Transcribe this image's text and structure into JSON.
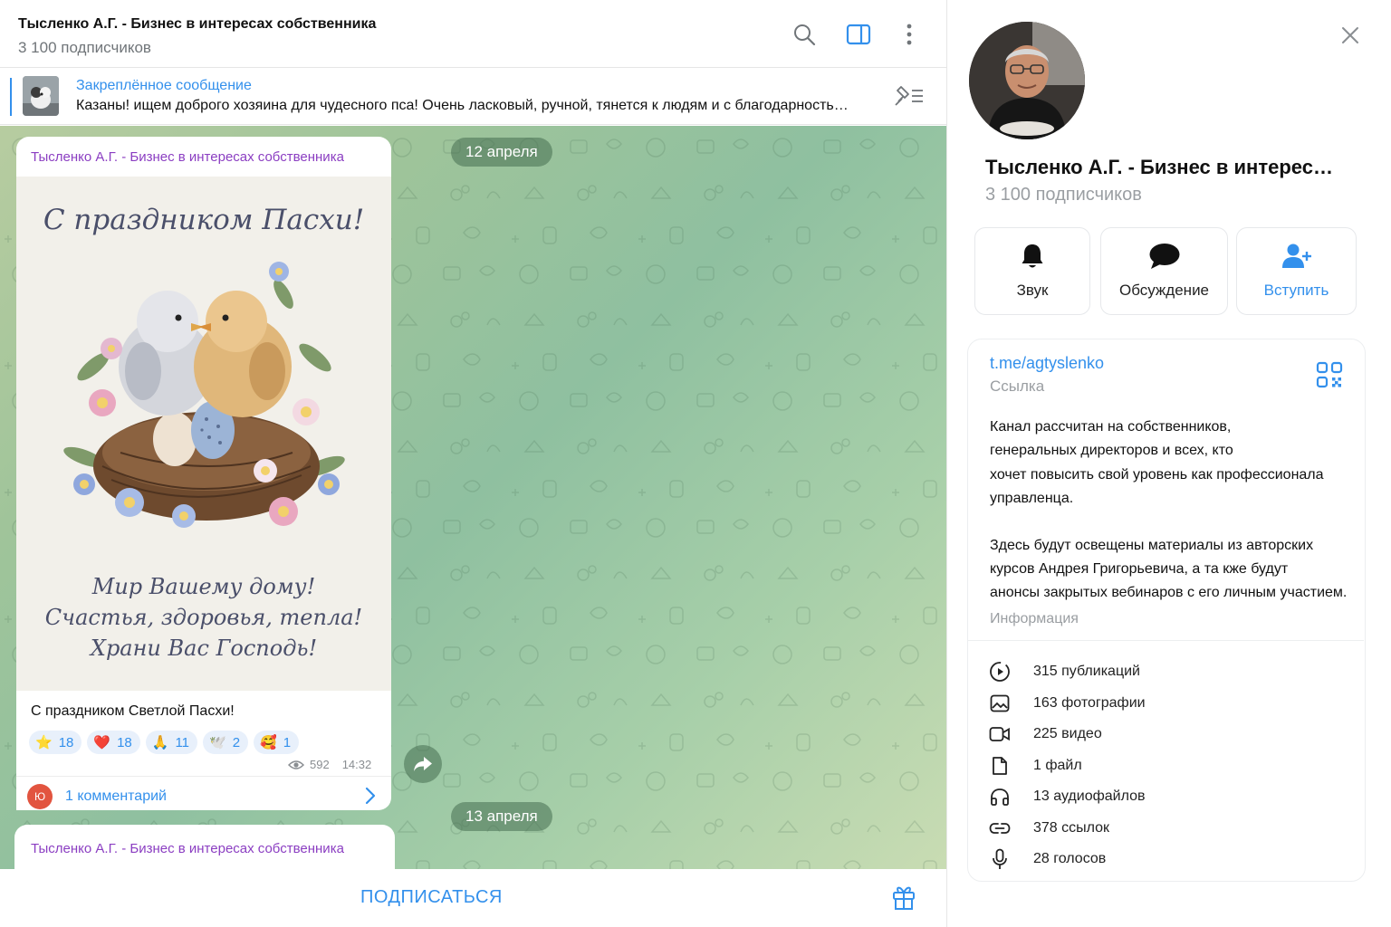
{
  "channel": {
    "title": "Тысленко А.Г. - Бизнес в интересах собственника",
    "subscribers": "3 100 подписчиков"
  },
  "pinned": {
    "title": "Закреплённое сообщение",
    "text": "Казаны! ищем доброго хозяина для чудесного пса!   Очень ласковый, ручной, тянется к людям  и с благодарность…"
  },
  "feed": {
    "date1": "12 апреля",
    "date2": "13 апреля",
    "post": {
      "author": "Тысленко А.Г. - Бизнес в интересах собственника",
      "card_title": "С праздником Пасхи!",
      "card_lines": [
        "Мир Вашему дому!",
        "Счастья, здоровья, тепла!",
        "Храни Вас Господь!"
      ],
      "caption": "С праздником Светлой Пасхи!",
      "reactions": [
        {
          "emoji": "⭐",
          "count": "18"
        },
        {
          "emoji": "❤️",
          "count": "18"
        },
        {
          "emoji": "🙏",
          "count": "11"
        },
        {
          "emoji": "🕊️",
          "count": "2"
        },
        {
          "emoji": "🥰",
          "count": "1"
        }
      ],
      "views": "592",
      "time": "14:32",
      "comment_avatar": "Ю",
      "comments": "1 комментарий"
    },
    "post2_author": "Тысленко А.Г. - Бизнес в интересах собственника"
  },
  "bottom": {
    "subscribe": "ПОДПИСАТЬСЯ"
  },
  "panel": {
    "title": "Тысленко А.Г. - Бизнес в интерес…",
    "subscribers": "3 100 подписчиков",
    "actions": {
      "sound": "Звук",
      "discussion": "Обсуждение",
      "join": "Вступить"
    },
    "link": "t.me/agtyslenko",
    "link_label": "Ссылка",
    "description": [
      [
        "Канал рассчитан на собственников,",
        "генеральных директоров и всех, кто",
        "хочет повысить свой уровень как профессионала",
        "управленца."
      ],
      [
        "Здесь будут освещены материалы из авторских",
        "курсов Андрея Григорьевича, а та кже будут",
        "анонсы закрытых вебинаров с его личным участием."
      ]
    ],
    "description_label": "Информация",
    "stats": [
      {
        "icon": "publications-icon",
        "label": "315 публикаций"
      },
      {
        "icon": "photos-icon",
        "label": "163 фотографии"
      },
      {
        "icon": "video-icon",
        "label": "225 видео"
      },
      {
        "icon": "file-icon",
        "label": "1 файл"
      },
      {
        "icon": "audio-icon",
        "label": "13 аудиофайлов"
      },
      {
        "icon": "link-icon",
        "label": "378 ссылок"
      },
      {
        "icon": "voice-icon",
        "label": "28 голосов"
      }
    ]
  },
  "colors": {
    "accent": "#3390ec",
    "author": "#8b3ec2",
    "muted": "#9a9ea2"
  }
}
